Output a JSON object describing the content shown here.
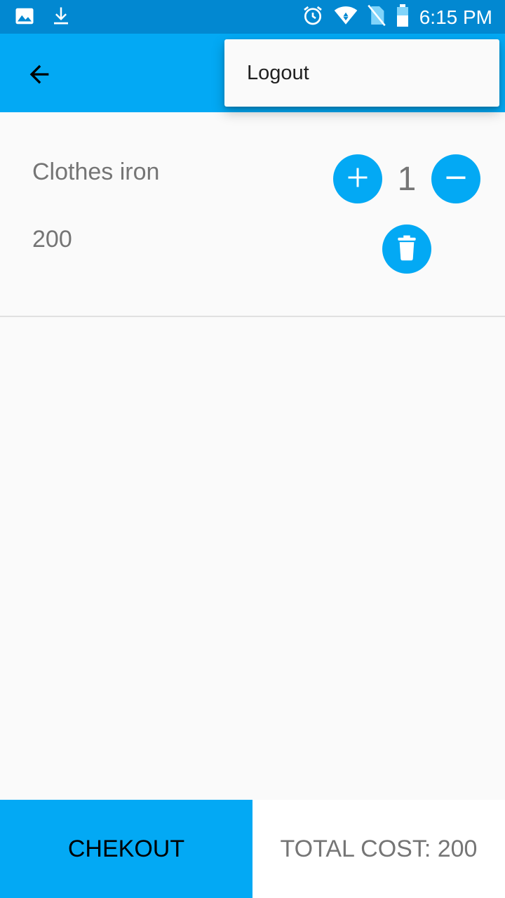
{
  "status_bar": {
    "time": "6:15 PM",
    "icons": [
      "image-icon",
      "download-icon",
      "alarm-icon",
      "wifi-icon",
      "no-sim-icon",
      "battery-icon"
    ]
  },
  "toolbar": {
    "back_icon": "arrow-back-icon",
    "color": "#03a9f4"
  },
  "overflow_menu": {
    "items": [
      {
        "label": "Logout"
      }
    ]
  },
  "cart": {
    "items": [
      {
        "name": "Clothes iron",
        "price": "200",
        "quantity": "1"
      }
    ]
  },
  "footer": {
    "checkout_label": "CHEKOUT",
    "total_label": "TOTAL COST: 200"
  },
  "colors": {
    "status_bar": "#0288d1",
    "accent": "#03a9f4",
    "text_secondary": "#757575"
  }
}
